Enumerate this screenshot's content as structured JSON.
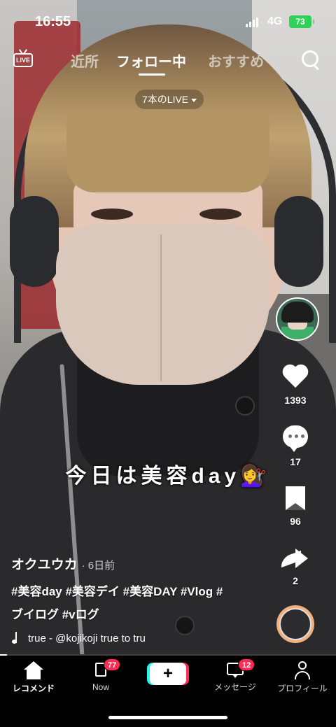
{
  "status_bar": {
    "time": "16:55",
    "network": "4G",
    "battery": "73"
  },
  "top_nav": {
    "live_icon_label": "LIVE",
    "tabs": [
      {
        "label": "近所",
        "active": false
      },
      {
        "label": "フォロー中",
        "active": true
      },
      {
        "label": "おすすめ",
        "active": false
      }
    ]
  },
  "live_count": "7本のLIVE",
  "actions": {
    "likes": "1393",
    "comments": "17",
    "saves": "96",
    "shares": "2"
  },
  "caption_overlay": "今日は美容day💇‍♀️",
  "post": {
    "author": "オクユウカ",
    "posted": "· 6日前",
    "description_line1": "#美容day #美容デイ #美容DAY #Vlog #",
    "description_line2": "ブイログ #vログ",
    "music": "true - @kojikoji    true to tru"
  },
  "playback_progress": 0.02,
  "tabbar": {
    "home": "レコメンド",
    "now": "Now",
    "now_badge": "77",
    "create": "+",
    "inbox": "メッセージ",
    "inbox_badge": "12",
    "profile": "プロフィール"
  },
  "colors": {
    "accent_red": "#fe2c55",
    "accent_cyan": "#25f4ee",
    "battery_green": "#2fd158"
  }
}
